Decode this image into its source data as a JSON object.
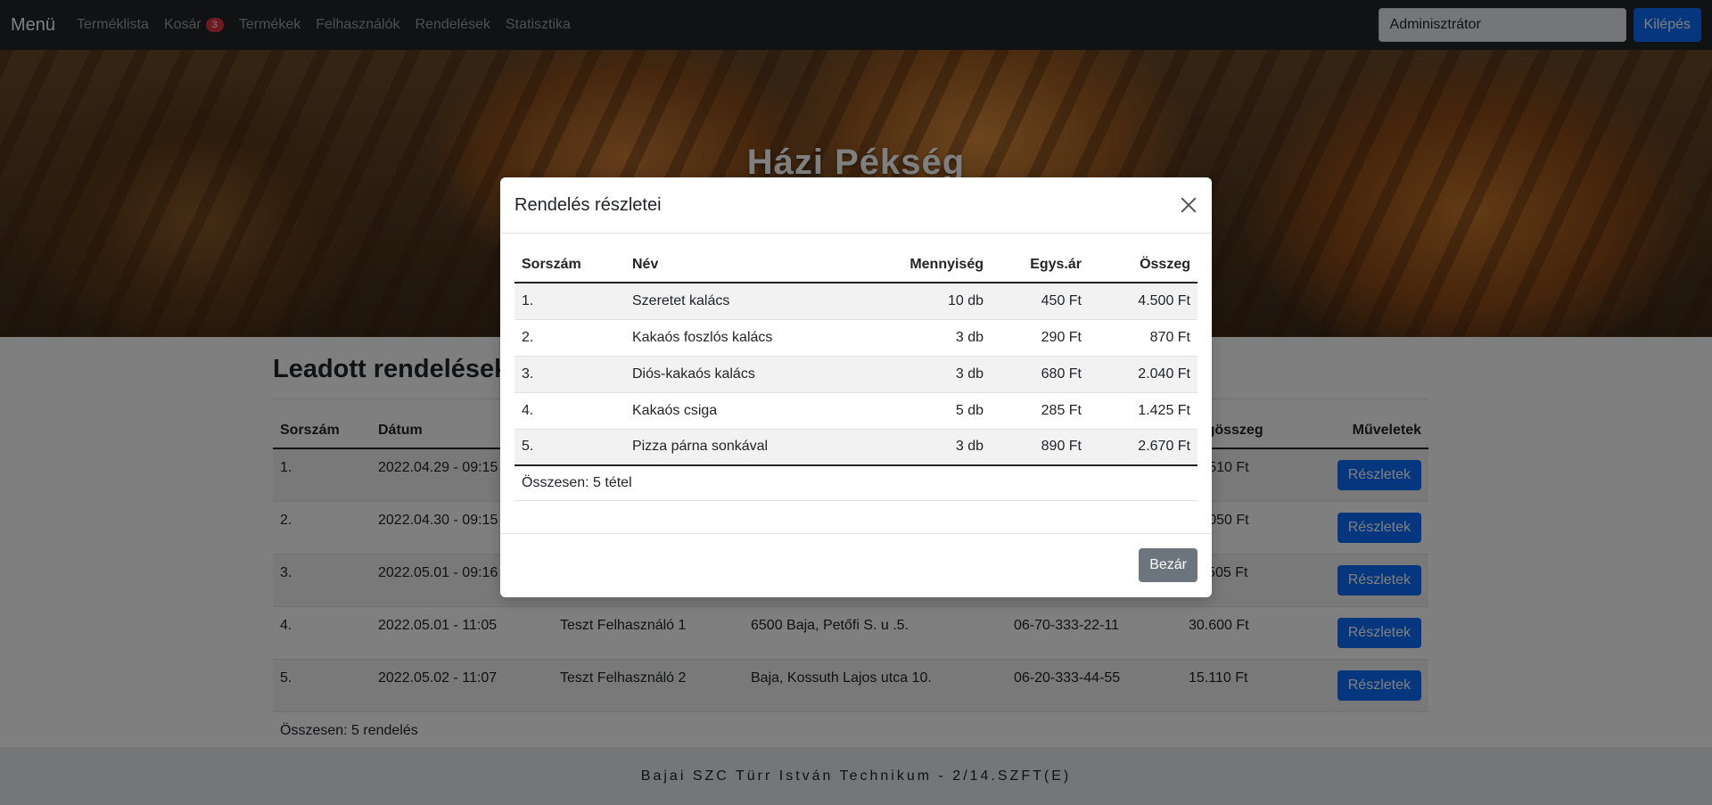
{
  "navbar": {
    "brand": "Menü",
    "links": [
      "Terméklista",
      "Kosár",
      "Termékek",
      "Felhasználók",
      "Rendelések",
      "Statisztika"
    ],
    "cart_count": "3",
    "user_value": "Adminisztrátor",
    "logout_label": "Kilépés"
  },
  "hero": {
    "title": "Házi Pékség"
  },
  "orders": {
    "title": "Leadott rendelések",
    "headers": {
      "number": "Sorszám",
      "date": "Dátum",
      "total": "Végösszeg",
      "actions": "Műveletek"
    },
    "rows": [
      {
        "number": "1.",
        "date": "2022.04.29 - 09:15",
        "name": "",
        "address": "",
        "phone": "",
        "total": "17.510 Ft",
        "action": "Részletek"
      },
      {
        "number": "2.",
        "date": "2022.04.30 - 09:15",
        "name": "",
        "address": "",
        "phone": "",
        "total": "14.050 Ft",
        "action": "Részletek"
      },
      {
        "number": "3.",
        "date": "2022.05.01 - 09:16",
        "name": "",
        "address": "",
        "phone": "",
        "total": "11.505 Ft",
        "action": "Részletek"
      },
      {
        "number": "4.",
        "date": "2022.05.01 - 11:05",
        "name": "Teszt Felhasználó 1",
        "address": "6500 Baja, Petőfi S. u .5.",
        "phone": "06-70-333-22-11",
        "total": "30.600 Ft",
        "action": "Részletek"
      },
      {
        "number": "5.",
        "date": "2022.05.02 - 11:07",
        "name": "Teszt Felhasználó 2",
        "address": "Baja, Kossuth Lajos utca 10.",
        "phone": "06-20-333-44-55",
        "total": "15.110 Ft",
        "action": "Részletek"
      }
    ],
    "summary": "Összesen: 5 rendelés"
  },
  "footer": {
    "text": "Bajai SZC Türr István Technikum - 2/14.SZFT(E)"
  },
  "modal": {
    "title": "Rendelés részletei",
    "headers": {
      "number": "Sorszám",
      "name": "Név",
      "qty": "Mennyiség",
      "unit": "Egys.ár",
      "sum": "Összeg"
    },
    "items": [
      {
        "number": "1.",
        "name": "Szeretet kalács",
        "qty": "10 db",
        "unit": "450 Ft",
        "sum": "4.500 Ft"
      },
      {
        "number": "2.",
        "name": "Kakaós foszlós kalács",
        "qty": "3 db",
        "unit": "290 Ft",
        "sum": "870 Ft"
      },
      {
        "number": "3.",
        "name": "Diós-kakaós kalács",
        "qty": "3 db",
        "unit": "680 Ft",
        "sum": "2.040 Ft"
      },
      {
        "number": "4.",
        "name": "Kakaós csiga",
        "qty": "5 db",
        "unit": "285 Ft",
        "sum": "1.425 Ft"
      },
      {
        "number": "5.",
        "name": "Pizza párna sonkával",
        "qty": "3 db",
        "unit": "890 Ft",
        "sum": "2.670 Ft"
      }
    ],
    "summary": "Összesen: 5 tétel",
    "close_label": "Bezár"
  },
  "colors": {
    "primary": "#0d6efd",
    "secondary": "#6c757d",
    "navbar": "#212529",
    "badge": "#dc3545"
  }
}
